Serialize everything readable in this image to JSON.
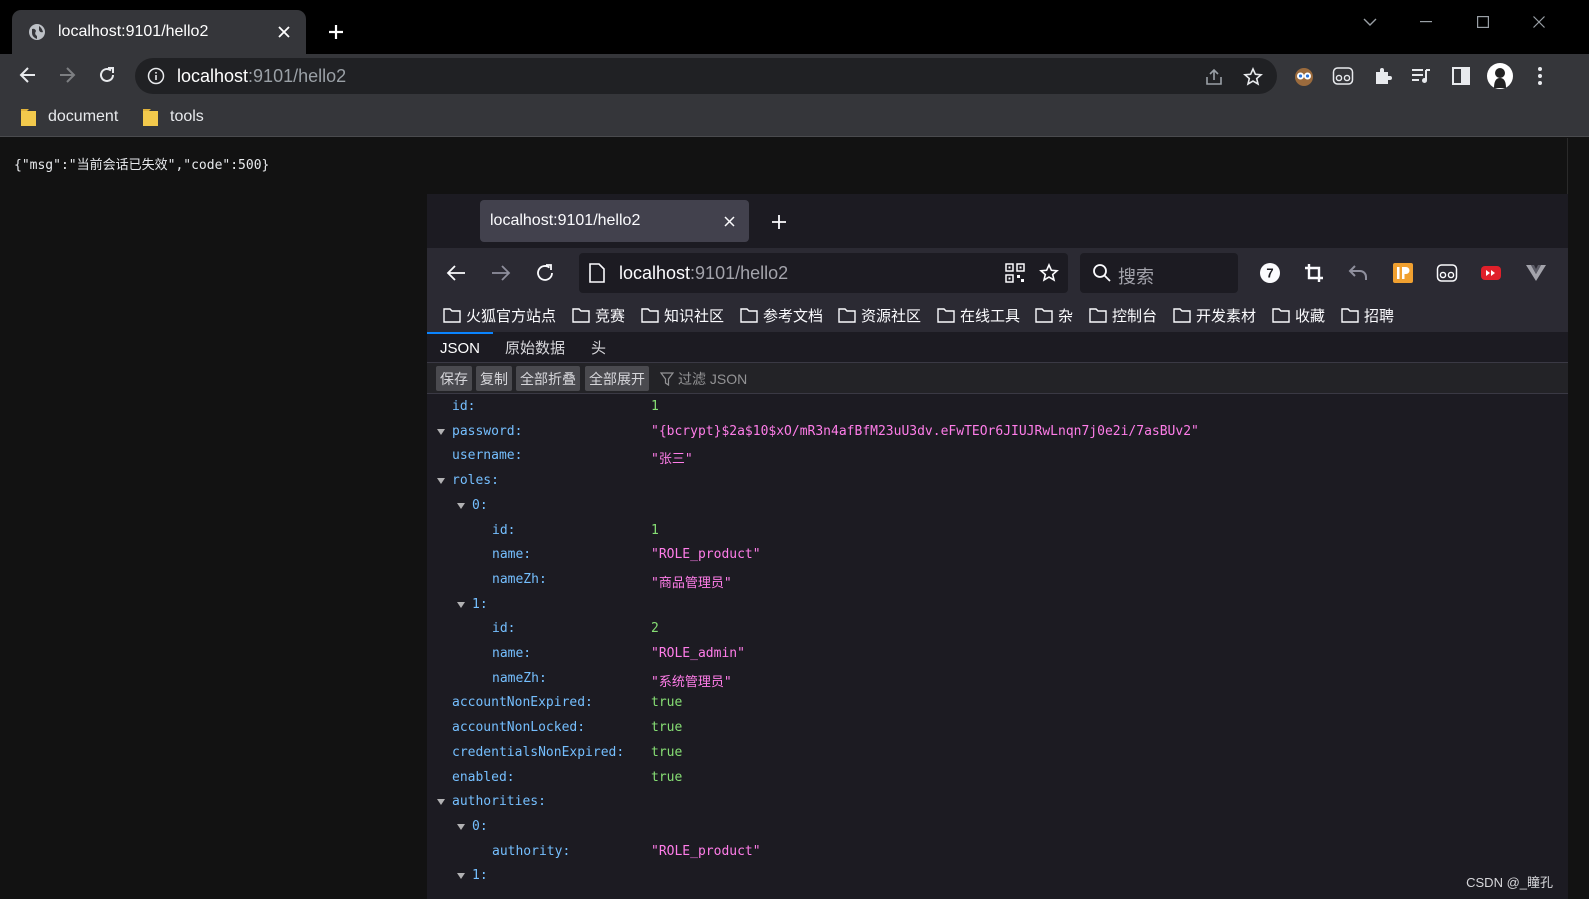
{
  "chrome": {
    "tab_title": "localhost:9101/hello2",
    "url_host": "localhost",
    "url_rest": ":9101/hello2",
    "bookmarks": [
      "document",
      "tools"
    ],
    "response_text": "{\"msg\":\"当前会话已失效\",\"code\":500}"
  },
  "firefox": {
    "tab_title": "localhost:9101/hello2",
    "url_host": "localhost",
    "url_rest": ":9101/hello2",
    "search_placeholder": "搜索",
    "extension_badge": "7",
    "bookmarks": [
      "火狐官方站点",
      "竞赛",
      "知识社区",
      "参考文档",
      "资源社区",
      "在线工具",
      "杂",
      "控制台",
      "开发素材",
      "收藏",
      "招聘"
    ],
    "viewer_tabs": [
      "JSON",
      "原始数据",
      "头"
    ],
    "toolbar_buttons": [
      "保存",
      "复制",
      "全部折叠",
      "全部展开"
    ],
    "filter_placeholder": "过滤 JSON",
    "json_rows": [
      {
        "key": "id:",
        "value": "1",
        "type": "num",
        "indent": 0,
        "toggle": false
      },
      {
        "key": "password:",
        "value": "\"{bcrypt}$2a$10$xO/mR3n4afBfM23uU3dv.eFwTEOr6JIUJRwLnqn7j0e2i/7asBUv2\"",
        "type": "str",
        "indent": 0,
        "toggle": true
      },
      {
        "key": "username:",
        "value": "\"张三\"",
        "type": "str",
        "indent": 0,
        "toggle": false
      },
      {
        "key": "roles:",
        "value": "",
        "type": "obj",
        "indent": 0,
        "toggle": true
      },
      {
        "key": "0:",
        "value": "",
        "type": "obj",
        "indent": 1,
        "toggle": true
      },
      {
        "key": "id:",
        "value": "1",
        "type": "num",
        "indent": 2,
        "toggle": false
      },
      {
        "key": "name:",
        "value": "\"ROLE_product\"",
        "type": "str",
        "indent": 2,
        "toggle": false
      },
      {
        "key": "nameZh:",
        "value": "\"商品管理员\"",
        "type": "str",
        "indent": 2,
        "toggle": false
      },
      {
        "key": "1:",
        "value": "",
        "type": "obj",
        "indent": 1,
        "toggle": true
      },
      {
        "key": "id:",
        "value": "2",
        "type": "num",
        "indent": 2,
        "toggle": false
      },
      {
        "key": "name:",
        "value": "\"ROLE_admin\"",
        "type": "str",
        "indent": 2,
        "toggle": false
      },
      {
        "key": "nameZh:",
        "value": "\"系统管理员\"",
        "type": "str",
        "indent": 2,
        "toggle": false
      },
      {
        "key": "accountNonExpired:",
        "value": "true",
        "type": "bool",
        "indent": 0,
        "toggle": false
      },
      {
        "key": "accountNonLocked:",
        "value": "true",
        "type": "bool",
        "indent": 0,
        "toggle": false
      },
      {
        "key": "credentialsNonExpired:",
        "value": "true",
        "type": "bool",
        "indent": 0,
        "toggle": false
      },
      {
        "key": "enabled:",
        "value": "true",
        "type": "bool",
        "indent": 0,
        "toggle": false
      },
      {
        "key": "authorities:",
        "value": "",
        "type": "obj",
        "indent": 0,
        "toggle": true
      },
      {
        "key": "0:",
        "value": "",
        "type": "obj",
        "indent": 1,
        "toggle": true
      },
      {
        "key": "authority:",
        "value": "\"ROLE_product\"",
        "type": "str",
        "indent": 2,
        "toggle": false
      },
      {
        "key": "1:",
        "value": "",
        "type": "obj",
        "indent": 1,
        "toggle": true
      }
    ]
  },
  "watermark": "CSDN @_瞳孔"
}
